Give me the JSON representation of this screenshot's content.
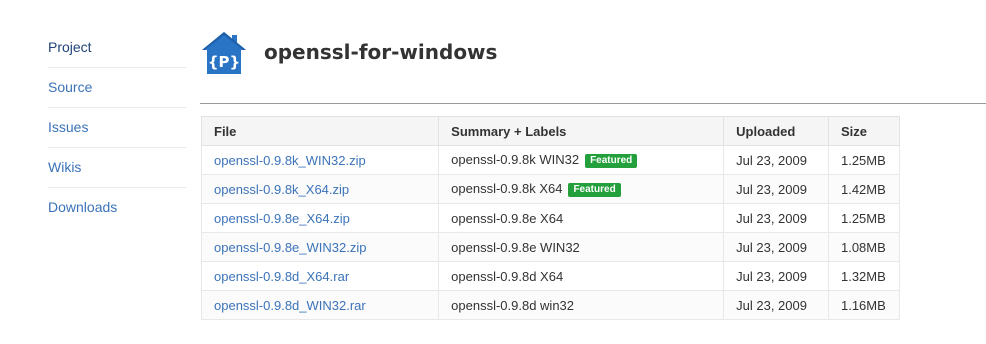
{
  "sidebar": {
    "items": [
      {
        "label": "Project"
      },
      {
        "label": "Source"
      },
      {
        "label": "Issues"
      },
      {
        "label": "Wikis"
      },
      {
        "label": "Downloads"
      }
    ]
  },
  "header": {
    "logo_icon": "project-logo-icon",
    "logo_text": "{P}",
    "title": "openssl-for-windows",
    "logo_color": "#2a74c6"
  },
  "table": {
    "headers": [
      "File",
      "Summary + Labels",
      "Uploaded",
      "Size"
    ],
    "badge_color": "#23a03b",
    "rows": [
      {
        "file": "openssl-0.9.8k_WIN32.zip",
        "summary": "openssl-0.9.8k WIN32",
        "badge": "Featured",
        "uploaded": "Jul 23, 2009",
        "size": "1.25MB"
      },
      {
        "file": "openssl-0.9.8k_X64.zip",
        "summary": "openssl-0.9.8k X64",
        "badge": "Featured",
        "uploaded": "Jul 23, 2009",
        "size": "1.42MB"
      },
      {
        "file": "openssl-0.9.8e_X64.zip",
        "summary": "openssl-0.9.8e X64",
        "badge": "",
        "uploaded": "Jul 23, 2009",
        "size": "1.25MB"
      },
      {
        "file": "openssl-0.9.8e_WIN32.zip",
        "summary": "openssl-0.9.8e WIN32",
        "badge": "",
        "uploaded": "Jul 23, 2009",
        "size": "1.08MB"
      },
      {
        "file": "openssl-0.9.8d_X64.rar",
        "summary": "openssl-0.9.8d X64",
        "badge": "",
        "uploaded": "Jul 23, 2009",
        "size": "1.32MB"
      },
      {
        "file": "openssl-0.9.8d_WIN32.rar",
        "summary": "openssl-0.9.8d win32",
        "badge": "",
        "uploaded": "Jul 23, 2009",
        "size": "1.16MB"
      }
    ]
  }
}
